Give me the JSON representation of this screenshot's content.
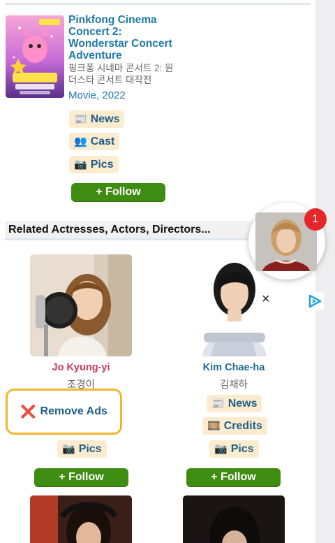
{
  "movie": {
    "title": "Pinkfong Cinema Concert 2: Wonderstar Concert Adventure",
    "korean_title": "핑크퐁 시네마 콘서트 2: 원더스타 콘서트 대작전",
    "type": "Movie",
    "separator": ",",
    "year": "2022",
    "poster_icon": "movie-poster",
    "links": [
      {
        "icon": "📰",
        "label": "News"
      },
      {
        "icon": "👥",
        "label": "Cast"
      },
      {
        "icon": "📷",
        "label": "Pics"
      }
    ],
    "follow_label": "+ Follow"
  },
  "related": {
    "heading": "Related Actresses, Actors, Directors...",
    "people": [
      {
        "name": "Jo Kyung-yi",
        "korean_name": "조경이",
        "name_color": "#c7385a",
        "links": [
          {
            "icon": "📷",
            "label": "Pics"
          }
        ],
        "follow_label": "+ Follow"
      },
      {
        "name": "Kim Chae-ha",
        "korean_name": "김채하",
        "name_color": "#1d6a93",
        "links": [
          {
            "icon": "📰",
            "label": "News"
          },
          {
            "icon": "🎞️",
            "label": "Credits"
          },
          {
            "icon": "📷",
            "label": "Pics"
          }
        ],
        "follow_label": "+ Follow"
      }
    ]
  },
  "overlay": {
    "notification_count": "1",
    "close_symbol": "×",
    "remove_ads_icon": "❌",
    "remove_ads_label": "Remove Ads"
  },
  "colors": {
    "link_blue": "#1d7aa7",
    "chip_bg": "#fbecd0",
    "follow_green": "#3f8c12",
    "badge_red": "#e5262b",
    "remove_ads_border": "#f2b62a"
  }
}
